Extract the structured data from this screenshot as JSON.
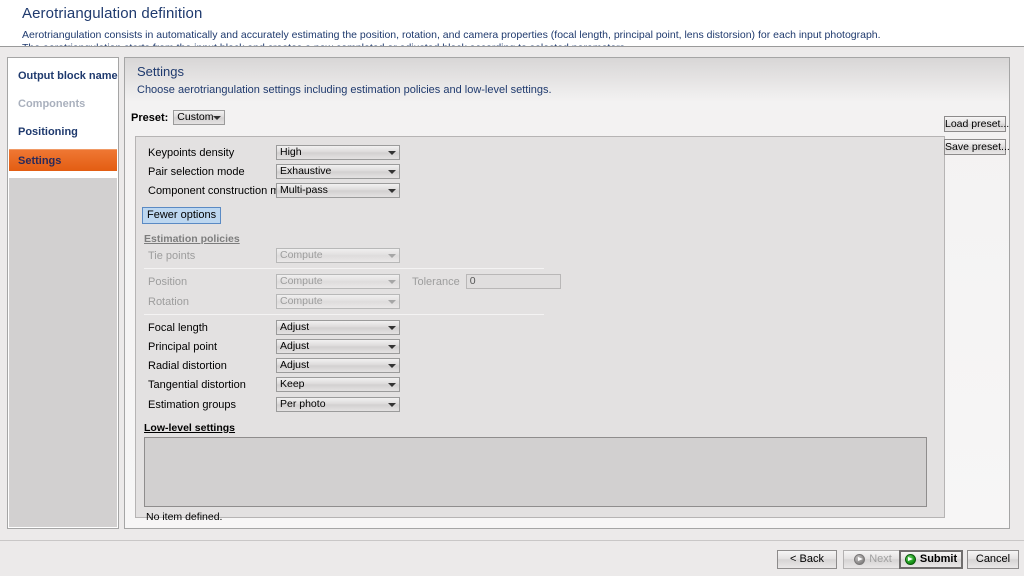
{
  "header": {
    "title": "Aerotriangulation definition",
    "description_line1": "Aerotriangulation consists in automatically and accurately estimating the position, rotation, and camera properties (focal length, principal point, lens distorsion) for each input photograph.",
    "description_line2": "The aerotriangulation starts from the input block and creates a new completed or adjusted block according to selected parameters."
  },
  "sidebar": {
    "items": [
      {
        "label": "Output block name",
        "state": "normal"
      },
      {
        "label": "Components",
        "state": "disabled"
      },
      {
        "label": "Positioning",
        "state": "normal"
      },
      {
        "label": "Settings",
        "state": "selected"
      }
    ]
  },
  "content": {
    "title": "Settings",
    "subtitle": "Choose aerotriangulation settings including estimation policies and low-level settings.",
    "preset_label": "Preset:",
    "preset_value": "Custom",
    "load_preset_label": "Load preset...",
    "save_preset_label": "Save preset...",
    "main_settings": [
      {
        "label": "Keypoints density",
        "value": "High"
      },
      {
        "label": "Pair selection mode",
        "value": "Exhaustive"
      },
      {
        "label": "Component construction mode",
        "value": "Multi-pass"
      }
    ],
    "fewer_options_label": "Fewer options",
    "estimation_policies_title": "Estimation policies",
    "estimation_policies": [
      {
        "label": "Tie points",
        "value": "Compute",
        "disabled": true
      },
      {
        "label": "Position",
        "value": "Compute",
        "disabled": true
      },
      {
        "label": "Rotation",
        "value": "Compute",
        "disabled": true
      }
    ],
    "tolerance_label": "Tolerance",
    "tolerance_value": "0",
    "camera_settings": [
      {
        "label": "Focal length",
        "value": "Adjust"
      },
      {
        "label": "Principal point",
        "value": "Adjust"
      },
      {
        "label": "Radial distortion",
        "value": "Adjust"
      },
      {
        "label": "Tangential distortion",
        "value": "Keep"
      },
      {
        "label": "Estimation groups",
        "value": "Per photo"
      }
    ],
    "low_level_title": "Low-level settings",
    "low_level_empty_text": "No item defined."
  },
  "footer": {
    "back_label": "< Back",
    "next_label": "Next",
    "submit_label": "Submit",
    "cancel_label": "Cancel"
  },
  "colors": {
    "accent_orange": "#e35d12",
    "title_blue": "#1F3A6E",
    "submit_green": "#199919"
  }
}
